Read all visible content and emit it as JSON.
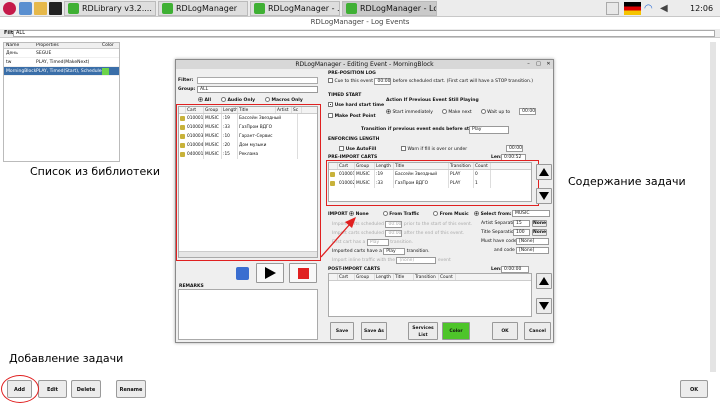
{
  "taskbar": {
    "tasks": [
      {
        "label": "RDLibrary v3.2...."
      },
      {
        "label": "RDLogManager"
      },
      {
        "label": "RDLogManager - ..."
      },
      {
        "label": "RDLogManager - Lo..."
      }
    ],
    "clock": "12:06"
  },
  "main": {
    "title": "RDLogManager - Log Events",
    "filter_label": "Filter:",
    "filter_value": "ALL",
    "columns": [
      "Name",
      "Properties",
      "Color"
    ],
    "events": [
      {
        "name": "День",
        "props": "SEGUE"
      },
      {
        "name": "tw",
        "props": "PLAY, Timed(MakeNext)"
      },
      {
        "name": "MorningBlock",
        "props": "PLAY, Timed(Start), Scheduled",
        "color": "#6cd44a",
        "selected": true
      }
    ],
    "buttons": {
      "add": "Add",
      "edit": "Edit",
      "delete": "Delete",
      "rename": "Rename",
      "ok": "OK"
    }
  },
  "annotations": {
    "library": "Список из библиотеки",
    "contents": "Содержание задачи",
    "add_task": "Добавление задачи"
  },
  "dialog": {
    "title": "RDLogManager - Editing Event - MorningBlock",
    "filter_label": "Filter:",
    "group_label": "Group:",
    "group_value": "ALL",
    "radio_all": "All",
    "radio_audio": "Audio Only",
    "radio_macros": "Macros Only",
    "lib_columns": [
      "Cart",
      "Group",
      "Length",
      "Title",
      "Artist",
      "Sc"
    ],
    "lib_rows": [
      {
        "cart": "010001",
        "group": "MUSIC",
        "length": ":19",
        "title": "Бассейн Звездный"
      },
      {
        "cart": "010002",
        "group": "MUSIC",
        "length": ":33",
        "title": "ГазПром ВДГО"
      },
      {
        "cart": "010003",
        "group": "MUSIC",
        "length": ":10",
        "title": "Гарант-Сервис"
      },
      {
        "cart": "010004",
        "group": "MUSIC",
        "length": ":20",
        "title": "Дом музыки"
      },
      {
        "cart": "040001",
        "group": "MUSIC",
        "length": ":15",
        "title": "Реклама"
      }
    ],
    "remarks_label": "REMARKS",
    "preposition": {
      "header": "PRE-POSITION LOG",
      "cue_label": "Cue to this event",
      "cue_value": "00:00",
      "cue_suffix": "before scheduled start. (First cart will have a STOP transition.)"
    },
    "timed_start": {
      "header": "TIMED START",
      "use_hard": "Use hard start time",
      "make_post": "Make Post Point",
      "action_header": "Action If Previous Event Still Playing",
      "start_immediately": "Start immediately",
      "make_next": "Make next",
      "wait_up_to": "Wait up to",
      "wait_value": "00:00",
      "transition_label": "Transition if previous event ends before start time:",
      "transition_value": "Play"
    },
    "enforcing": {
      "header": "ENFORCING LENGTH",
      "use_autofill": "Use AutoFill",
      "warn_label": "Warn if fill is over or under",
      "len_value": "00:00"
    },
    "pre_import": {
      "header": "PRE-IMPORT CARTS",
      "len_label": "Len:",
      "len_value": "0:00:52",
      "columns": [
        "Cart",
        "Group",
        "Length",
        "Title",
        "Transition",
        "Count"
      ],
      "rows": [
        {
          "cart": "010001",
          "group": "MUSIC",
          "length": ":19",
          "title": "Бассейн Звездный",
          "transition": "PLAY",
          "count": "0"
        },
        {
          "cart": "010002",
          "group": "MUSIC",
          "length": ":33",
          "title": "ГазПром ВДГО",
          "transition": "PLAY",
          "count": "1"
        }
      ]
    },
    "import": {
      "header": "IMPORT",
      "none": "None",
      "from_traffic": "From Traffic",
      "from_music": "From Music",
      "select_from": "Select from:",
      "select_value": "MUSIC",
      "start_sched": "Import carts scheduled",
      "end_sched": "Import carts scheduled",
      "start_suffix": "prior to the start of this event.",
      "end_suffix": "after the end of this event.",
      "time_value": "00:00",
      "first_cart": "First cart has a",
      "first_value": "Play",
      "first_suffix": "transition.",
      "imported_label": "Imported carts have a",
      "imported_value": "Play",
      "imported_suffix": "transition.",
      "inline_label": "Import inline traffic with the",
      "inline_value": "(none)",
      "inline_suffix": "event",
      "artist_sep": "Artist Separation",
      "artist_value": "15",
      "title_sep": "Title Separation",
      "title_value": "100",
      "must_have": "Must have code",
      "must_value": "[None]",
      "and_code": "and code",
      "and_value": "[None]",
      "none_btn": "None"
    },
    "post_import": {
      "header": "POST-IMPORT CARTS",
      "len_label": "Len:",
      "len_value": "0:00:00",
      "columns": [
        "Cart",
        "Group",
        "Length",
        "Title",
        "Transition",
        "Count"
      ]
    },
    "buttons": {
      "save": "Save",
      "save_as": "Save As",
      "services": "Services List",
      "color": "Color",
      "ok": "OK",
      "cancel": "Cancel"
    },
    "colors": {
      "color_button": "#4ec52a",
      "stop": "#e02020"
    }
  }
}
